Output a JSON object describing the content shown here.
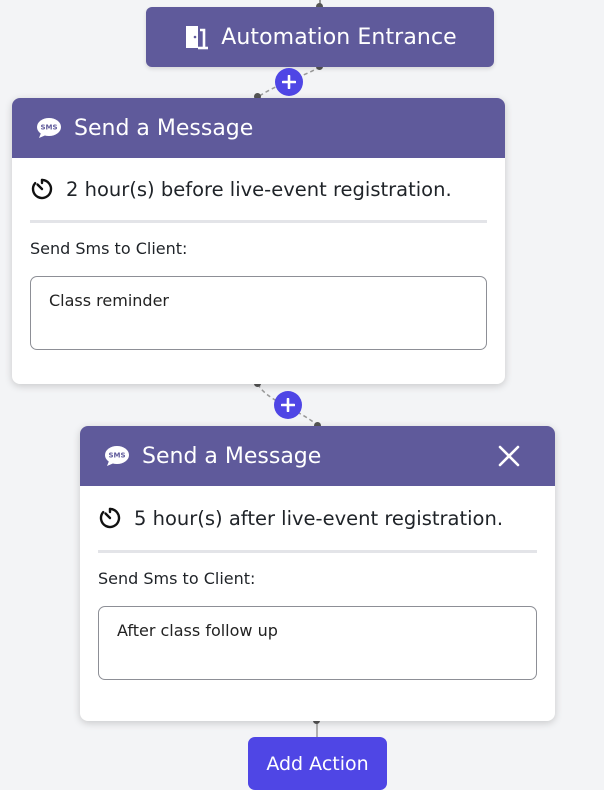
{
  "entrance": {
    "label": "Automation Entrance",
    "icon": "door-icon"
  },
  "steps": [
    {
      "title": "Send a Message",
      "icon": "sms-icon",
      "timing": "2 hour(s) before live-event registration.",
      "field_label": "Send Sms to Client:",
      "message": "Class reminder"
    },
    {
      "title": "Send a Message",
      "icon": "sms-icon",
      "timing": "5 hour(s) after live-event registration.",
      "field_label": "Send Sms to Client:",
      "message": "After class follow up",
      "close_icon": "close-icon"
    }
  ],
  "add_action": {
    "label": "Add Action"
  },
  "colors": {
    "header": "#5f5a9b",
    "accent": "#4f46e5",
    "background": "#f3f4f6"
  }
}
